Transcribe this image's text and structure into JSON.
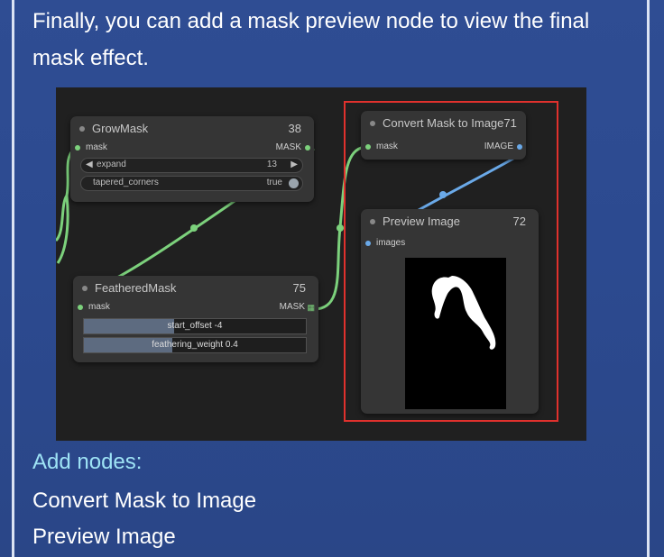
{
  "intro_text": "Finally, you can add a mask preview node to view the final mask effect.",
  "nodes": {
    "growmask": {
      "title": "GrowMask",
      "id": "38",
      "input": "mask",
      "output": "MASK",
      "expand_label": "expand",
      "expand_value": "13",
      "tapered_label": "tapered_corners",
      "tapered_value": "true"
    },
    "feathered": {
      "title": "FeatheredMask",
      "id": "75",
      "input": "mask",
      "output": "MASK",
      "start_offset": "start_offset -4",
      "feathering_weight": "feathering_weight 0.4"
    },
    "convert": {
      "title": "Convert Mask to Image",
      "id": "71",
      "input": "mask",
      "output": "IMAGE"
    },
    "preview": {
      "title": "Preview Image",
      "id": "72",
      "input": "images"
    }
  },
  "footer": {
    "heading": "Add nodes:",
    "items": [
      "Convert Mask to Image",
      "Preview Image"
    ]
  },
  "colors": {
    "accent": "#9ee3f5",
    "highlight": "#e0312d",
    "mask_link": "#7cd17c",
    "image_link": "#6aa9e8"
  }
}
